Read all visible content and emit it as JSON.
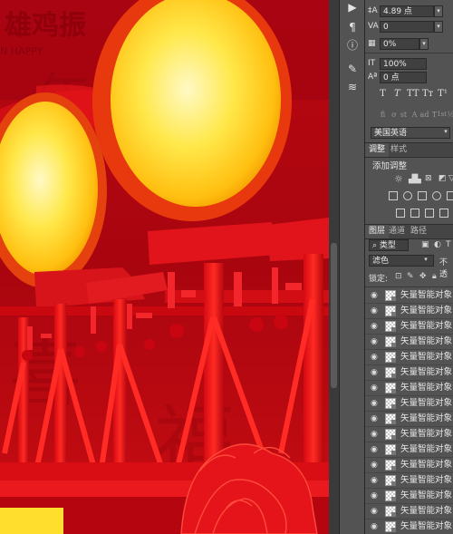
{
  "canvas": {
    "header_text": "雄鸡振",
    "bg_text": "N HAPPY"
  },
  "toolstrip": {
    "icons": [
      "play-icon",
      "paragraph-icon",
      "info-icon",
      "brush-settings-icon",
      "adjust-icon"
    ]
  },
  "character": {
    "leading_value": "4.89 点",
    "tracking_value": "0",
    "scale_value": "0%",
    "vertical_scale_value": "100%",
    "baseline_value": "0 点",
    "style_buttons": [
      "T",
      "T",
      "TT",
      "Tт",
      "T¹"
    ],
    "opentype_buttons": [
      "fi",
      "ơ",
      "st",
      "A",
      "ad",
      "T",
      "1st",
      "½"
    ],
    "language": "美国英语"
  },
  "adjustments": {
    "tabs": [
      "调整",
      "样式"
    ],
    "title": "添加调整"
  },
  "layers": {
    "tabs": [
      "图层",
      "通道",
      "路径"
    ],
    "filter_kind": "类型",
    "blend_mode": "滤色",
    "opacity_label": "不透",
    "lock_label": "锁定:",
    "items": [
      "矢量智能对象",
      "矢量智能对象",
      "矢量智能对象",
      "矢量智能对象",
      "矢量智能对象",
      "矢量智能对象",
      "矢量智能对象",
      "矢量智能对象",
      "矢量智能对象",
      "矢量智能对象",
      "矢量智能对象",
      "矢量智能对象",
      "矢量智能对象",
      "矢量智能对象",
      "矢量智能对象",
      "矢量智能对象",
      "矢量智能对象"
    ]
  },
  "colors": {
    "panel_bg": "#535353",
    "canvas_red": "#c40810",
    "lantern_yellow": "#ffd21f"
  }
}
